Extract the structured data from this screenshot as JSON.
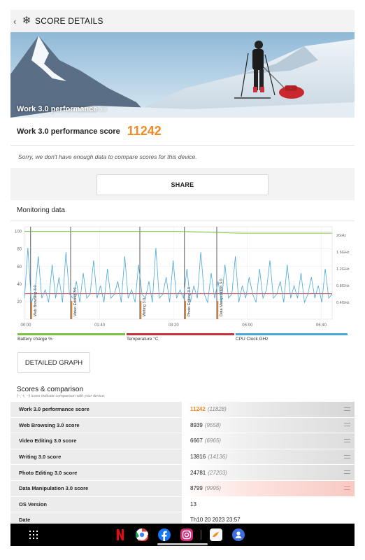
{
  "header": {
    "back_icon": "chevron-left-icon",
    "app_icon": "snowflake-icon",
    "title": "SCORE DETAILS"
  },
  "hero": {
    "title": "Work 3.0 performance",
    "version": "3.0"
  },
  "score": {
    "label": "Work 3.0 performance score",
    "value": "11242"
  },
  "note": "Sorry, we don't have enough data to compare scores for this device.",
  "share_label": "SHARE",
  "monitoring": {
    "title": "Monitoring data",
    "chart_data": {
      "type": "line",
      "x_ticks": [
        "00:00",
        "01:40",
        "03:20",
        "05:00",
        "06:40"
      ],
      "y_left_ticks": [
        "100",
        "80",
        "60",
        "40",
        "20"
      ],
      "y_right_ticks": [
        "2GHz",
        "1.6GHz",
        "1.2GHz",
        "0.8GHz",
        "0.4GHz"
      ],
      "ylim_left": [
        0,
        100
      ],
      "ylim_right": [
        0,
        2.2
      ],
      "section_markers": [
        {
          "label": "Web Browsing 3.0",
          "t": 0.02
        },
        {
          "label": "Video Editing 3.0",
          "t": 0.15
        },
        {
          "label": "Writing 3.0",
          "t": 0.375
        },
        {
          "label": "Photo Editing 3.0",
          "t": 0.52
        },
        {
          "label": "Data Manipulation 3.0",
          "t": 0.625
        }
      ],
      "series": [
        {
          "name": "Battery charge %",
          "color": "#7cc242",
          "values": [
            100,
            100,
            100,
            100,
            100,
            100,
            99,
            98,
            98,
            98,
            98
          ]
        },
        {
          "name": "Temperature °C",
          "color": "#c8323c",
          "values": [
            29,
            29,
            29,
            29,
            29,
            29,
            29,
            29,
            29,
            29,
            29
          ]
        },
        {
          "name": "CPU Clock GHz",
          "color": "#4aa8d8",
          "values": [
            0.5,
            1.7,
            0.4,
            0.6,
            1.5,
            0.5,
            0.7,
            0.4,
            1.3,
            0.5,
            1.0,
            0.4,
            1.6,
            0.6,
            0.5,
            0.9,
            0.4,
            1.1,
            0.5,
            0.6,
            1.4,
            0.5,
            0.8,
            0.4,
            1.2,
            0.5,
            0.6,
            0.9,
            0.4,
            1.5,
            0.5,
            0.7,
            0.4,
            1.3,
            0.6,
            0.5,
            0.9,
            0.4,
            1.7,
            0.5,
            0.6,
            1.0,
            0.4,
            1.4,
            0.5,
            0.7,
            0.5,
            1.2,
            0.4,
            0.8,
            0.5,
            1.6,
            0.6,
            0.4,
            1.1,
            0.5,
            0.9,
            0.4,
            1.3,
            0.5,
            0.6,
            1.5,
            0.4,
            0.8,
            0.5,
            1.0,
            0.6,
            0.4,
            1.2,
            0.5,
            0.7,
            1.4,
            0.5,
            0.6,
            0.9,
            0.4,
            1.3,
            0.5,
            0.8,
            0.5,
            1.1,
            0.4,
            0.6,
            1.0,
            0.5,
            0.8,
            0.4,
            1.2,
            0.5,
            0.6
          ]
        }
      ]
    }
  },
  "legend": [
    {
      "label": "Battery charge %",
      "color": "#7cc242"
    },
    {
      "label": "Temperature °C",
      "color": "#c8323c"
    },
    {
      "label": "CPU Clock GHz",
      "color": "#4aa8d8"
    }
  ],
  "detailed_graph_label": "DETAILED GRAPH",
  "scores": {
    "title": "Scores & comparison",
    "subtitle": "(–, +, –) icons indicate comparison with your device.",
    "rows": [
      {
        "name": "Work 3.0 performance score",
        "value": "11242",
        "compare": "(11828)"
      },
      {
        "name": "Web Browsing 3.0 score",
        "value": "8939",
        "compare": "(9558)"
      },
      {
        "name": "Video Editing 3.0 score",
        "value": "6667",
        "compare": "(6965)"
      },
      {
        "name": "Writing 3.0 score",
        "value": "13816",
        "compare": "(14136)"
      },
      {
        "name": "Photo Editing 3.0 score",
        "value": "24781",
        "compare": "(27203)"
      },
      {
        "name": "Data Manipulation 3.0 score",
        "value": "8799",
        "compare": "(9995)"
      },
      {
        "name": "OS Version",
        "value": "13",
        "compare": ""
      },
      {
        "name": "Date",
        "value": "Th10 20 2023 23:57",
        "compare": ""
      }
    ]
  },
  "navbar": {
    "apps_icon": "app-grid-icon",
    "apps": [
      "netflix-icon",
      "chrome-icon",
      "facebook-icon",
      "instagram-icon",
      "swift-keyboard-icon",
      "app-icon"
    ]
  }
}
